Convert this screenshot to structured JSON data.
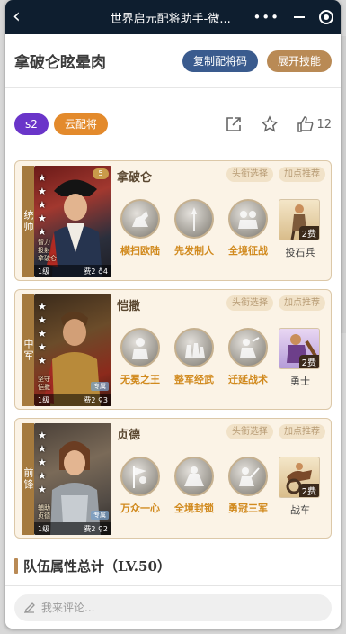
{
  "window": {
    "title": "世界启元配将助手-微..."
  },
  "header": {
    "title": "拿破仑眩晕肉",
    "copy_button": "复制配将码",
    "expand_button": "展开技能"
  },
  "tags": [
    "s2",
    "云配将"
  ],
  "likes": "12",
  "chip_labels": {
    "avatar": "头衔选择",
    "recommend": "加点推荐"
  },
  "cards": [
    {
      "role": "统帅",
      "name": "拿破仑",
      "portrait_text": [
        "智力",
        "投射",
        "拿破仑"
      ],
      "level": "1级",
      "cost_label": "费2 ♁4",
      "badge": "5",
      "skills": [
        "横扫欧陆",
        "先发制人",
        "全境征战"
      ],
      "troop": "投石兵",
      "troop_cost": "2费"
    },
    {
      "role": "中军",
      "name": "恺撒",
      "portrait_text": [
        "坚守",
        "恺撒"
      ],
      "spec": "专属",
      "level": "1级",
      "cost_label": "费2 ⚲3",
      "skills": [
        "无冕之王",
        "整军经武",
        "迁延战术"
      ],
      "troop": "勇士",
      "troop_cost": "2费"
    },
    {
      "role": "前锋",
      "name": "贞德",
      "portrait_text": [
        "辅助",
        "贞德"
      ],
      "spec": "专属",
      "level": "1级",
      "cost_label": "费2 ⚲2",
      "skills": [
        "万众一心",
        "全境封锁",
        "勇冠三军"
      ],
      "troop": "战车",
      "troop_cost": "2费"
    }
  ],
  "team_attr_title": "队伍属性总计（LV.50）",
  "comment_placeholder": "我来评论..."
}
